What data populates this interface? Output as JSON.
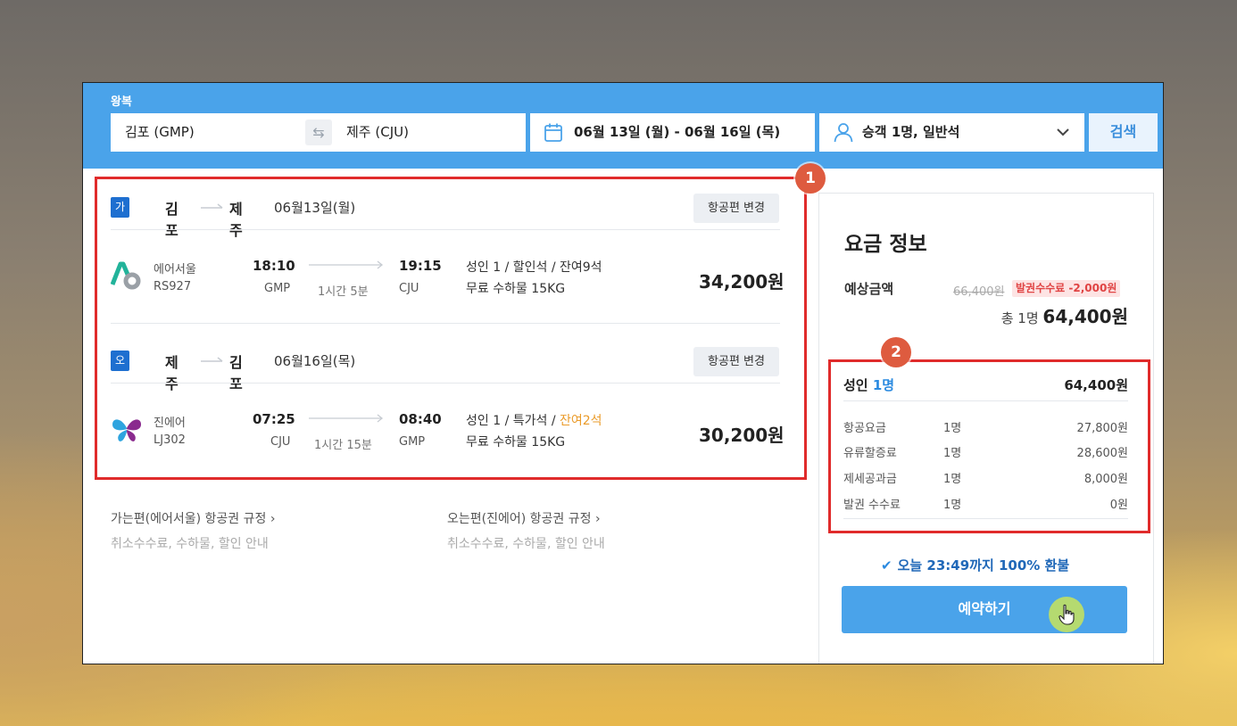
{
  "search": {
    "trip_type": "왕복",
    "from": "김포 (GMP)",
    "to": "제주 (CJU)",
    "dates": "06월 13일 (월)  -  06월 16일 (목)",
    "passengers": "승객 1명, 일반석",
    "search_label": "검색",
    "swap_glyph": "⇆"
  },
  "markers": [
    "1",
    "2"
  ],
  "outbound": {
    "badge": "가는편",
    "from": "김포",
    "to": "제주",
    "date": "06월13일(월)",
    "change_label": "항공편 변경",
    "airline": "에어서울",
    "flight_no": "RS927",
    "dep_time": "18:10",
    "dep_airport": "GMP",
    "duration": "1시간 5분",
    "arr_time": "19:15",
    "arr_airport": "CJU",
    "seat_info": "성인 1 / 할인석 / 잔여9석",
    "baggage": "무료 수하물 15KG",
    "price": "34,200원"
  },
  "inbound": {
    "badge": "오는편",
    "from": "제주",
    "to": "김포",
    "date": "06월16일(목)",
    "change_label": "항공편 변경",
    "airline": "진에어",
    "flight_no": "LJ302",
    "dep_time": "07:25",
    "dep_airport": "CJU",
    "duration": "1시간 15분",
    "arr_time": "08:40",
    "arr_airport": "GMP",
    "seat_info_prefix": "성인 1 / 특가석 / ",
    "seat_info_warn": "잔여2석",
    "baggage": "무료 수하물 15KG",
    "price": "30,200원"
  },
  "rules": {
    "out_title": "가는편(에어서울) 항공권 규정  ›",
    "out_sub": "취소수수료, 수하물, 할인 안내",
    "in_title": "오는편(진에어) 항공권 규정  ›",
    "in_sub": "취소수수료, 수하물, 할인 안내"
  },
  "fare": {
    "title": "요금 정보",
    "estimate_label": "예상금액",
    "original_price": "66,400원",
    "fee_badge": "발권수수료 -2,000원",
    "total_prefix": "총 1명 ",
    "total_amount": "64,400원",
    "breakdown_head_prefix": "성인 ",
    "breakdown_head_count": "1명",
    "breakdown_head_amount": "64,400원",
    "rows": [
      {
        "label": "항공요금",
        "qty": "1명",
        "amount": "27,800원"
      },
      {
        "label": "유류할증료",
        "qty": "1명",
        "amount": "28,600원"
      },
      {
        "label": "제세공과금",
        "qty": "1명",
        "amount": "8,000원"
      },
      {
        "label": "발권 수수료",
        "qty": "1명",
        "amount": "0원"
      }
    ],
    "refund_check": "✔",
    "refund_text": "오늘 23:49까지 100% 환불",
    "book_label": "예약하기"
  },
  "colors": {
    "header_blue": "#4aa3ea",
    "badge_blue": "#1e6fd0",
    "highlight_red": "#e02b2b",
    "marker_orange": "#de5b3f",
    "seat_warning": "#ea9b2a"
  }
}
